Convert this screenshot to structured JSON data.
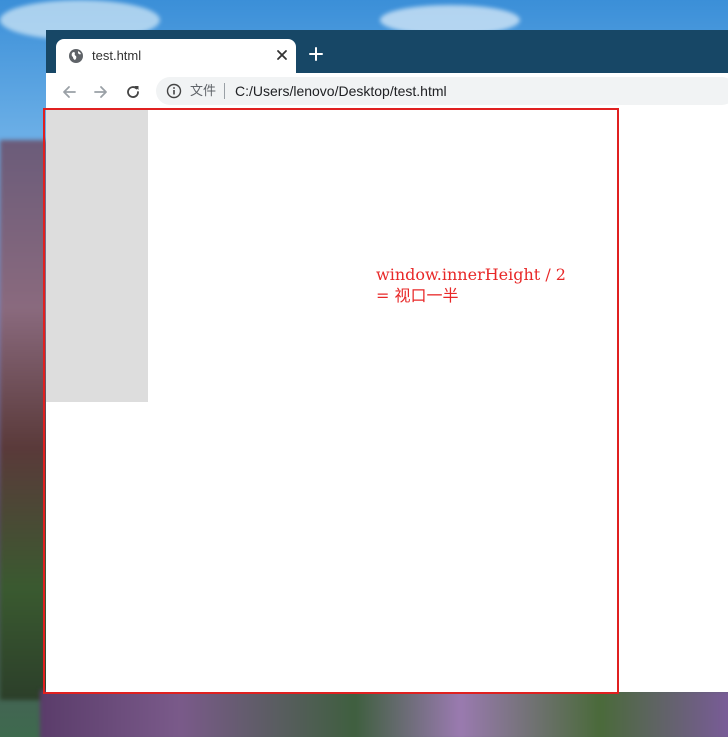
{
  "browser": {
    "tab": {
      "title": "test.html",
      "favicon": "globe-icon",
      "close_icon": "close-icon"
    },
    "new_tab_icon": "plus-icon",
    "toolbar": {
      "back_icon": "arrow-left-icon",
      "forward_icon": "arrow-right-icon",
      "reload_icon": "reload-icon",
      "info_icon": "info-icon",
      "scheme_label": "文件",
      "url": "C:/Users/lenovo/Desktop/test.html"
    },
    "colors": {
      "titlebar": "#174766",
      "gray_box": "#dddddd",
      "annotation": "#e82828"
    }
  },
  "annotation": {
    "line1": "window.innerHeight / 2",
    "line2": "= 视口一半"
  }
}
